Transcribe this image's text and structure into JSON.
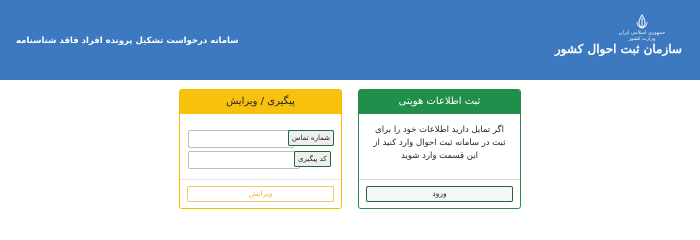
{
  "header": {
    "title": "سامانه درخواست تشکیل پرونده افراد فاقد شناسنامه",
    "logo": {
      "republic_text": "جمهوری اسلامی ایران",
      "ministry_text": "وزارت کشور",
      "org_name": "سازمان ثبت احوال کشور"
    },
    "background_color": "#3d79c1"
  },
  "register_card": {
    "title": "ثبت اطلاعات هویتی",
    "description": "اگر تمایل دارید اطلاعات خود را برای ثبت در سامانه ثبت احوال وارد کنید از این قسمت وارد شوید",
    "login_button": "ورود",
    "accent_color": "#208f4b"
  },
  "tracking_card": {
    "title": "پیگیری / ویرایش",
    "phone_label": "شماره تماس",
    "phone_value": "",
    "tracking_label": "کد پیگیری",
    "tracking_value": "",
    "edit_button": "ویرایش",
    "accent_color": "#f7c10d"
  }
}
